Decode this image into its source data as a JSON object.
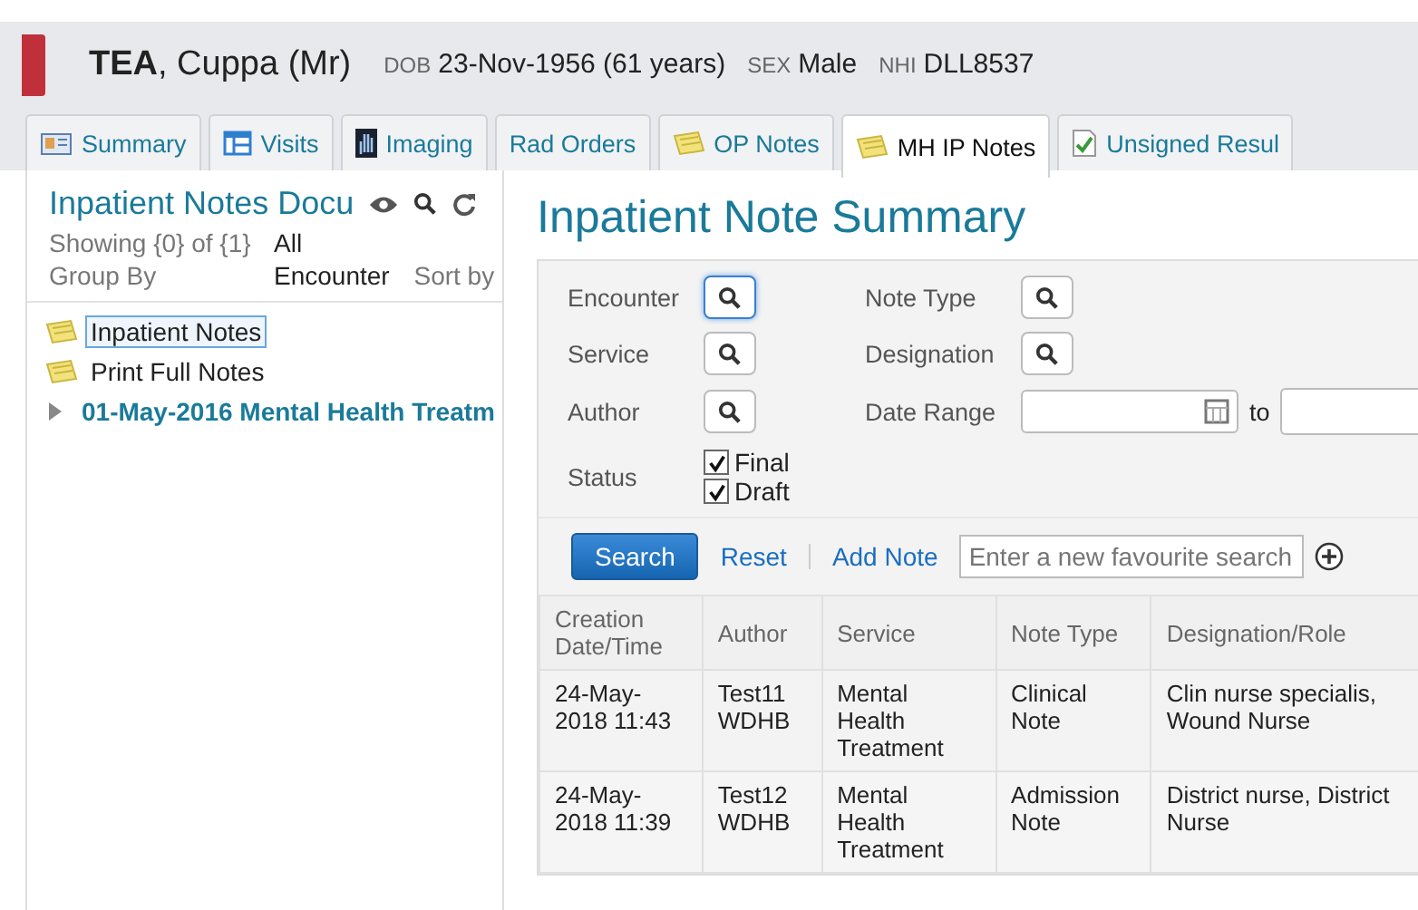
{
  "patient": {
    "surname": "TEA",
    "given": ", Cuppa (Mr)",
    "fields": [
      {
        "label": "DOB",
        "value": "23-Nov-1956 (61 years)"
      },
      {
        "label": "SEX",
        "value": "Male"
      },
      {
        "label": "NHI",
        "value": "DLL8537"
      }
    ]
  },
  "tabs": [
    {
      "label": "Summary",
      "kind": "card",
      "selected": false
    },
    {
      "label": "Visits",
      "kind": "table",
      "selected": false
    },
    {
      "label": "Imaging",
      "kind": "xray",
      "selected": false
    },
    {
      "label": "Rad Orders",
      "kind": "none",
      "selected": false
    },
    {
      "label": "OP Notes",
      "kind": "note",
      "selected": false
    },
    {
      "label": "MH IP Notes",
      "kind": "note",
      "selected": true
    },
    {
      "label": "Unsigned Resul",
      "kind": "check",
      "selected": false
    }
  ],
  "sidebar": {
    "title": "Inpatient Notes Docu",
    "showing": "Showing {0} of {1}",
    "showing_value": "All",
    "group_by": "Group By",
    "group_value": "Encounter",
    "sort_by": "Sort by",
    "items": [
      {
        "label": "Inpatient Notes",
        "kind": "note",
        "selected": true
      },
      {
        "label": "Print Full Notes",
        "kind": "note",
        "selected": false
      },
      {
        "label": "01-May-2016 Mental Health Treatm",
        "kind": "folder",
        "expanded": false,
        "selected": false
      }
    ]
  },
  "main": {
    "title": "Inpatient Note Summary",
    "filters": [
      {
        "label": "Encounter",
        "kind": "lookup",
        "focused": true
      },
      {
        "label": "Note Type",
        "kind": "lookup",
        "focused": false
      },
      {
        "label": "Service",
        "kind": "lookup",
        "focused": false
      },
      {
        "label": "Designation",
        "kind": "lookup",
        "focused": false
      },
      {
        "label": "Author",
        "kind": "lookup",
        "focused": false
      },
      {
        "label": "Date Range",
        "kind": "date",
        "to": "to"
      }
    ],
    "status_label": "Status",
    "statuses": [
      {
        "label": "Final",
        "checked": true
      },
      {
        "label": "Draft",
        "checked": true
      }
    ],
    "search_button": "Search",
    "reset_link": "Reset",
    "add_note_link": "Add Note",
    "favourite": {
      "placeholder": "Enter a new favourite search"
    },
    "table": {
      "columns": [
        "Creation Date/Time",
        "Author",
        "Service",
        "Note Type",
        "Designation/Role"
      ],
      "rows": [
        [
          "24-May-2018 11:43",
          "Test11 WDHB",
          "Mental Health Treatment",
          "Clinical Note",
          "Clin nurse specialis, Wound Nurse"
        ],
        [
          "24-May-2018 11:39",
          "Test12 WDHB",
          "Mental Health Treatment",
          "Admission Note",
          "District nurse, District Nurse"
        ]
      ]
    }
  }
}
